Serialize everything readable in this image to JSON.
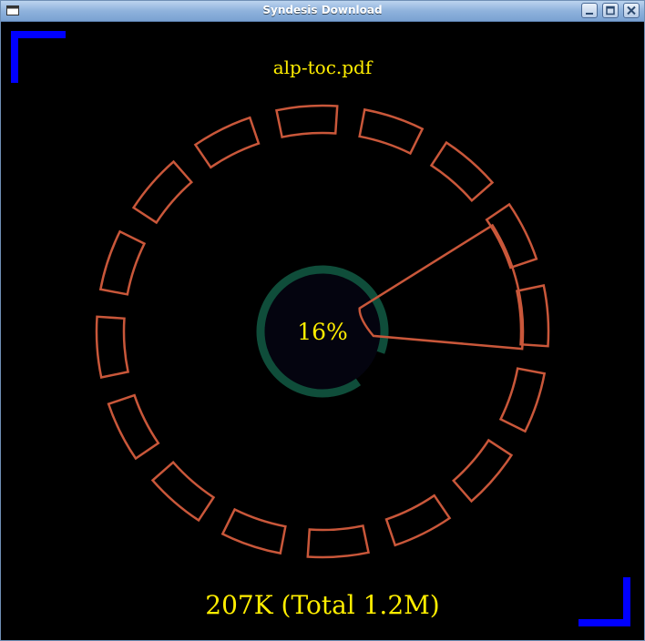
{
  "window": {
    "title": "Syndesis Download"
  },
  "download": {
    "filename": "alp-toc.pdf",
    "percent_label": "16%",
    "progress": 0.16,
    "size_label": "207K (Total 1.2M)"
  },
  "colors": {
    "text": "#ffee00",
    "ring_segment": "#c9573a",
    "progress_ring": "#0f4d3a",
    "corner_bracket": "#0000ff",
    "background": "#000000"
  },
  "icons": {
    "app": "window-icon",
    "minimize": "minimize-icon",
    "maximize": "maximize-icon",
    "close": "close-icon"
  }
}
